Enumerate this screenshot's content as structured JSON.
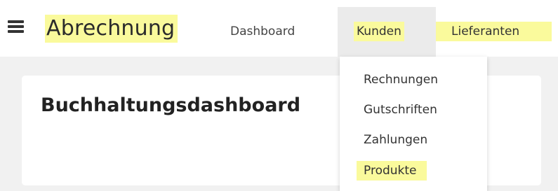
{
  "app": {
    "title": "Abrechnung"
  },
  "navbar": {
    "items": [
      {
        "label": "Dashboard"
      },
      {
        "label": "Kunden"
      },
      {
        "label": "Lieferanten"
      }
    ]
  },
  "dropdown": {
    "items": [
      {
        "label": "Rechnungen"
      },
      {
        "label": "Gutschriften"
      },
      {
        "label": "Zahlungen"
      },
      {
        "label": "Produkte"
      }
    ]
  },
  "main": {
    "card_title": "Buchhaltungsdashboard"
  },
  "colors": {
    "highlight": "#fafa9c",
    "page_background": "#f1f1f1",
    "active_nav_background": "#ebebeb"
  },
  "icons": {
    "menu": "hamburger-menu-icon"
  }
}
